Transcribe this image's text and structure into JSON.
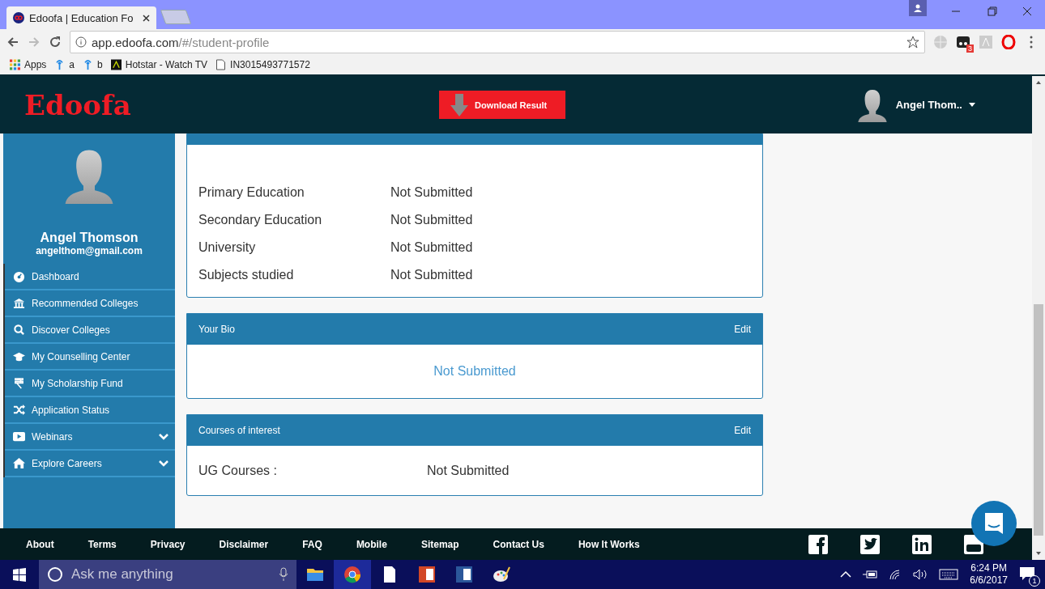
{
  "browser": {
    "tab_title": "Edoofa | Education Fo",
    "address_host": "app.edoofa.com",
    "address_path": "/#/student-profile",
    "extension_badge": "3",
    "bookmarks": [
      {
        "kind": "apps",
        "label": "Apps"
      },
      {
        "kind": "pin",
        "label": "a"
      },
      {
        "kind": "pin",
        "label": "b"
      },
      {
        "kind": "hotstar",
        "label": "Hotstar - Watch TV"
      },
      {
        "kind": "page",
        "label": "IN3015493771572"
      }
    ]
  },
  "header": {
    "logo": "Edoofa",
    "download_button": "Download Result",
    "user_name": "Angel Thom.."
  },
  "sidebar": {
    "name": "Angel Thomson",
    "email": "angelthom@gmail.com",
    "items": [
      {
        "label": "Dashboard",
        "expandable": false
      },
      {
        "label": "Recommended Colleges",
        "expandable": false
      },
      {
        "label": "Discover Colleges",
        "expandable": false
      },
      {
        "label": "My Counselling Center",
        "expandable": false
      },
      {
        "label": "My Scholarship Fund",
        "expandable": false
      },
      {
        "label": "Application Status",
        "expandable": false
      },
      {
        "label": "Webinars",
        "expandable": true
      },
      {
        "label": "Explore Careers",
        "expandable": true
      }
    ]
  },
  "education": {
    "rows": [
      {
        "label": "Primary Education",
        "value": "Not Submitted"
      },
      {
        "label": "Secondary Education",
        "value": "Not Submitted"
      },
      {
        "label": "University",
        "value": "Not Submitted"
      },
      {
        "label": "Subjects studied",
        "value": "Not Submitted"
      }
    ]
  },
  "bio": {
    "title": "Your Bio",
    "edit": "Edit",
    "text": "Not Submitted"
  },
  "courses": {
    "title": "Courses of interest",
    "edit": "Edit",
    "rows": [
      {
        "label": "UG Courses :",
        "value": "Not Submitted"
      }
    ]
  },
  "footer": {
    "links": [
      "About",
      "Terms",
      "Privacy",
      "Disclaimer",
      "FAQ",
      "Mobile",
      "Sitemap",
      "Contact Us",
      "How It Works"
    ]
  },
  "taskbar": {
    "search_placeholder": "Ask me anything",
    "time": "6:24 PM",
    "date": "6/6/2017",
    "notifications": "1"
  }
}
